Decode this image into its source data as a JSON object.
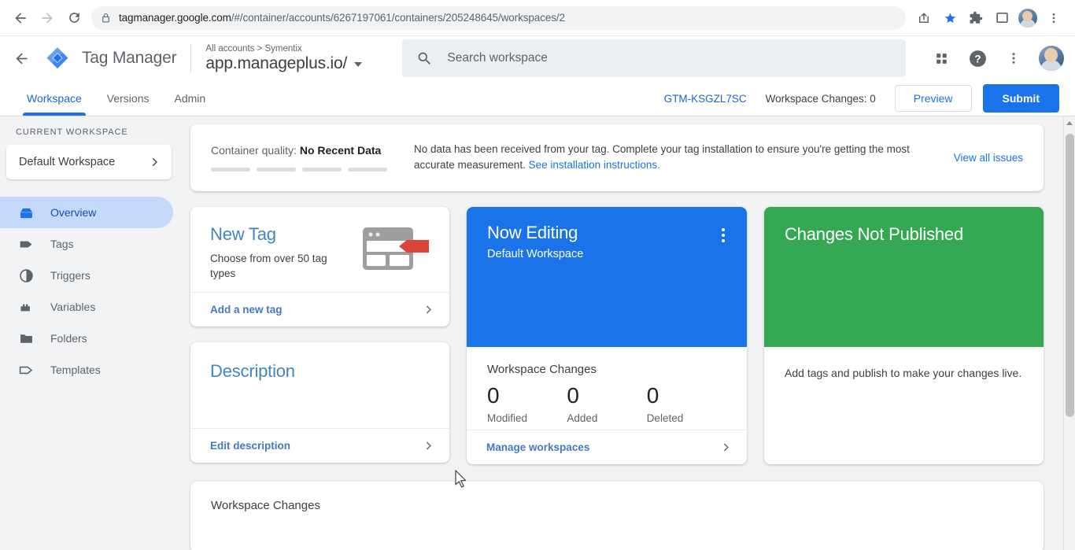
{
  "browser": {
    "url_host": "tagmanager.google.com",
    "url_path": "/#/container/accounts/6267197061/containers/205248645/workspaces/2",
    "back_icon": "back-arrow-icon",
    "forward_icon": "forward-arrow-icon",
    "reload_icon": "reload-icon",
    "lock_icon": "lock-icon",
    "share_icon": "share-icon",
    "bookmark_icon": "star-icon",
    "extensions_icon": "puzzle-icon",
    "panel_icon": "side-panel-icon",
    "profile_icon": "profile-avatar",
    "menu_icon": "three-dot-menu-icon"
  },
  "header": {
    "brand": "Tag Manager",
    "logo_icon": "tag-manager-logo",
    "breadcrumb": "All accounts > Symentix",
    "container_name": "app.manageplus.io/",
    "search_placeholder": "Search workspace",
    "search_icon": "search-icon",
    "apps_icon": "apps-grid-icon",
    "help_icon": "help-circle-icon",
    "more_icon": "three-dot-menu-icon",
    "account_icon": "account-avatar"
  },
  "tabs": [
    {
      "label": "Workspace",
      "active": true
    },
    {
      "label": "Versions",
      "active": false
    },
    {
      "label": "Admin",
      "active": false
    }
  ],
  "tab_actions": {
    "container_id": "GTM-KSGZL7SC",
    "workspace_changes": "Workspace Changes: 0",
    "preview_label": "Preview",
    "submit_label": "Submit"
  },
  "sidebar": {
    "section_label": "CURRENT WORKSPACE",
    "workspace_name": "Default Workspace",
    "workspace_chevron": "chevron-right-icon",
    "items": [
      {
        "label": "Overview",
        "icon": "overview-icon",
        "active": true
      },
      {
        "label": "Tags",
        "icon": "tag-icon",
        "active": false
      },
      {
        "label": "Triggers",
        "icon": "trigger-icon",
        "active": false
      },
      {
        "label": "Variables",
        "icon": "variables-icon",
        "active": false
      },
      {
        "label": "Folders",
        "icon": "folder-icon",
        "active": false
      },
      {
        "label": "Templates",
        "icon": "template-icon",
        "active": false
      }
    ]
  },
  "quality_banner": {
    "label": "Container quality:",
    "status": "No Recent Data",
    "message_part1": "No data has been received from your tag. Complete your tag installation to ensure you're getting the most accurate measurement.",
    "message_link": "See installation instructions.",
    "view_issues": "View all issues",
    "bars": 4
  },
  "cards": {
    "new_tag": {
      "title": "New Tag",
      "subtitle": "Choose from over 50 tag types",
      "illustration": "browser-tag-illustration",
      "footer_link": "Add a new tag",
      "footer_chevron": "chevron-right-icon"
    },
    "description": {
      "title": "Description",
      "footer_link": "Edit description",
      "footer_chevron": "chevron-right-icon"
    },
    "now_editing": {
      "title": "Now Editing",
      "subtitle": "Default Workspace",
      "menu_icon": "kebab-menu-icon",
      "stats_title": "Workspace Changes",
      "stats": [
        {
          "value": "0",
          "label": "Modified"
        },
        {
          "value": "0",
          "label": "Added"
        },
        {
          "value": "0",
          "label": "Deleted"
        }
      ],
      "footer_link": "Manage workspaces",
      "footer_chevron": "chevron-right-icon",
      "accent_color": "#1a73e8"
    },
    "not_published": {
      "title": "Changes Not Published",
      "body": "Add tags and publish to make your changes live.",
      "accent_color": "#34a853"
    }
  },
  "bottom_section": {
    "title": "Workspace Changes"
  },
  "colors": {
    "blue": "#1a73e8",
    "green": "#34a853",
    "link_blue": "#1967d2",
    "sidebar_active": "#c5dafb",
    "page_bg": "#f1f3f4"
  }
}
